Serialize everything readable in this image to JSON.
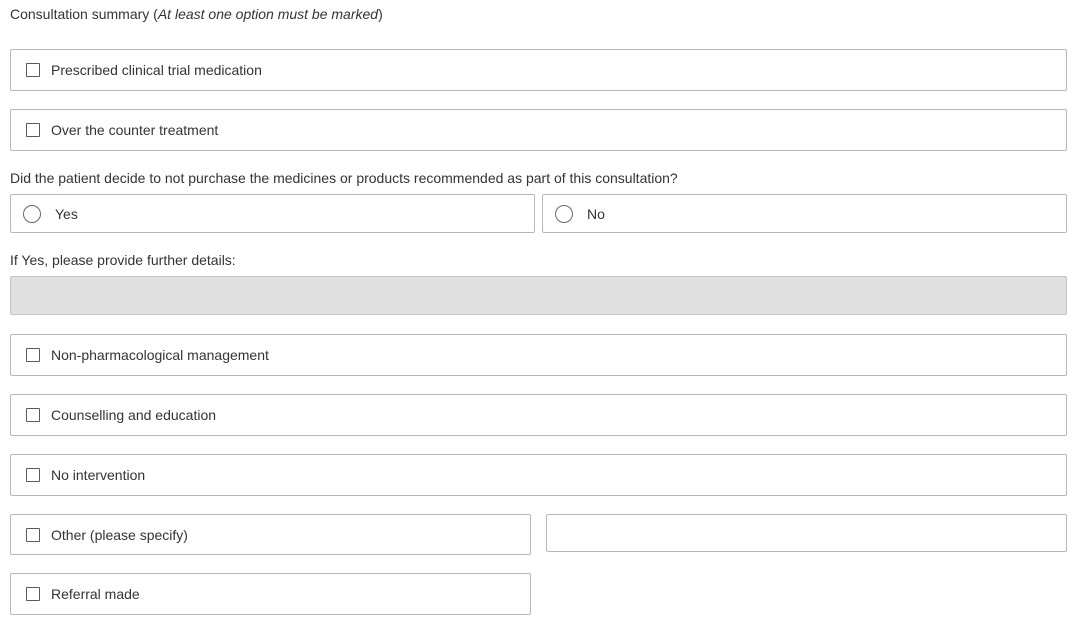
{
  "heading": {
    "label": "Consultation summary",
    "note": "At least one option must be marked"
  },
  "options": {
    "prescribed": "Prescribed clinical trial medication",
    "otc": "Over the counter treatment",
    "non_pharm": "Non-pharmacological management",
    "counselling": "Counselling and education",
    "no_intervention": "No intervention",
    "other": "Other (please specify)",
    "referral": "Referral made"
  },
  "question": {
    "text": "Did the patient decide to not purchase the medicines or products recommended as part of this consultation?",
    "yes_label": "Yes",
    "no_label": "No"
  },
  "details": {
    "label": "If Yes, please provide further details:",
    "value": ""
  },
  "other_specify": {
    "value": ""
  }
}
